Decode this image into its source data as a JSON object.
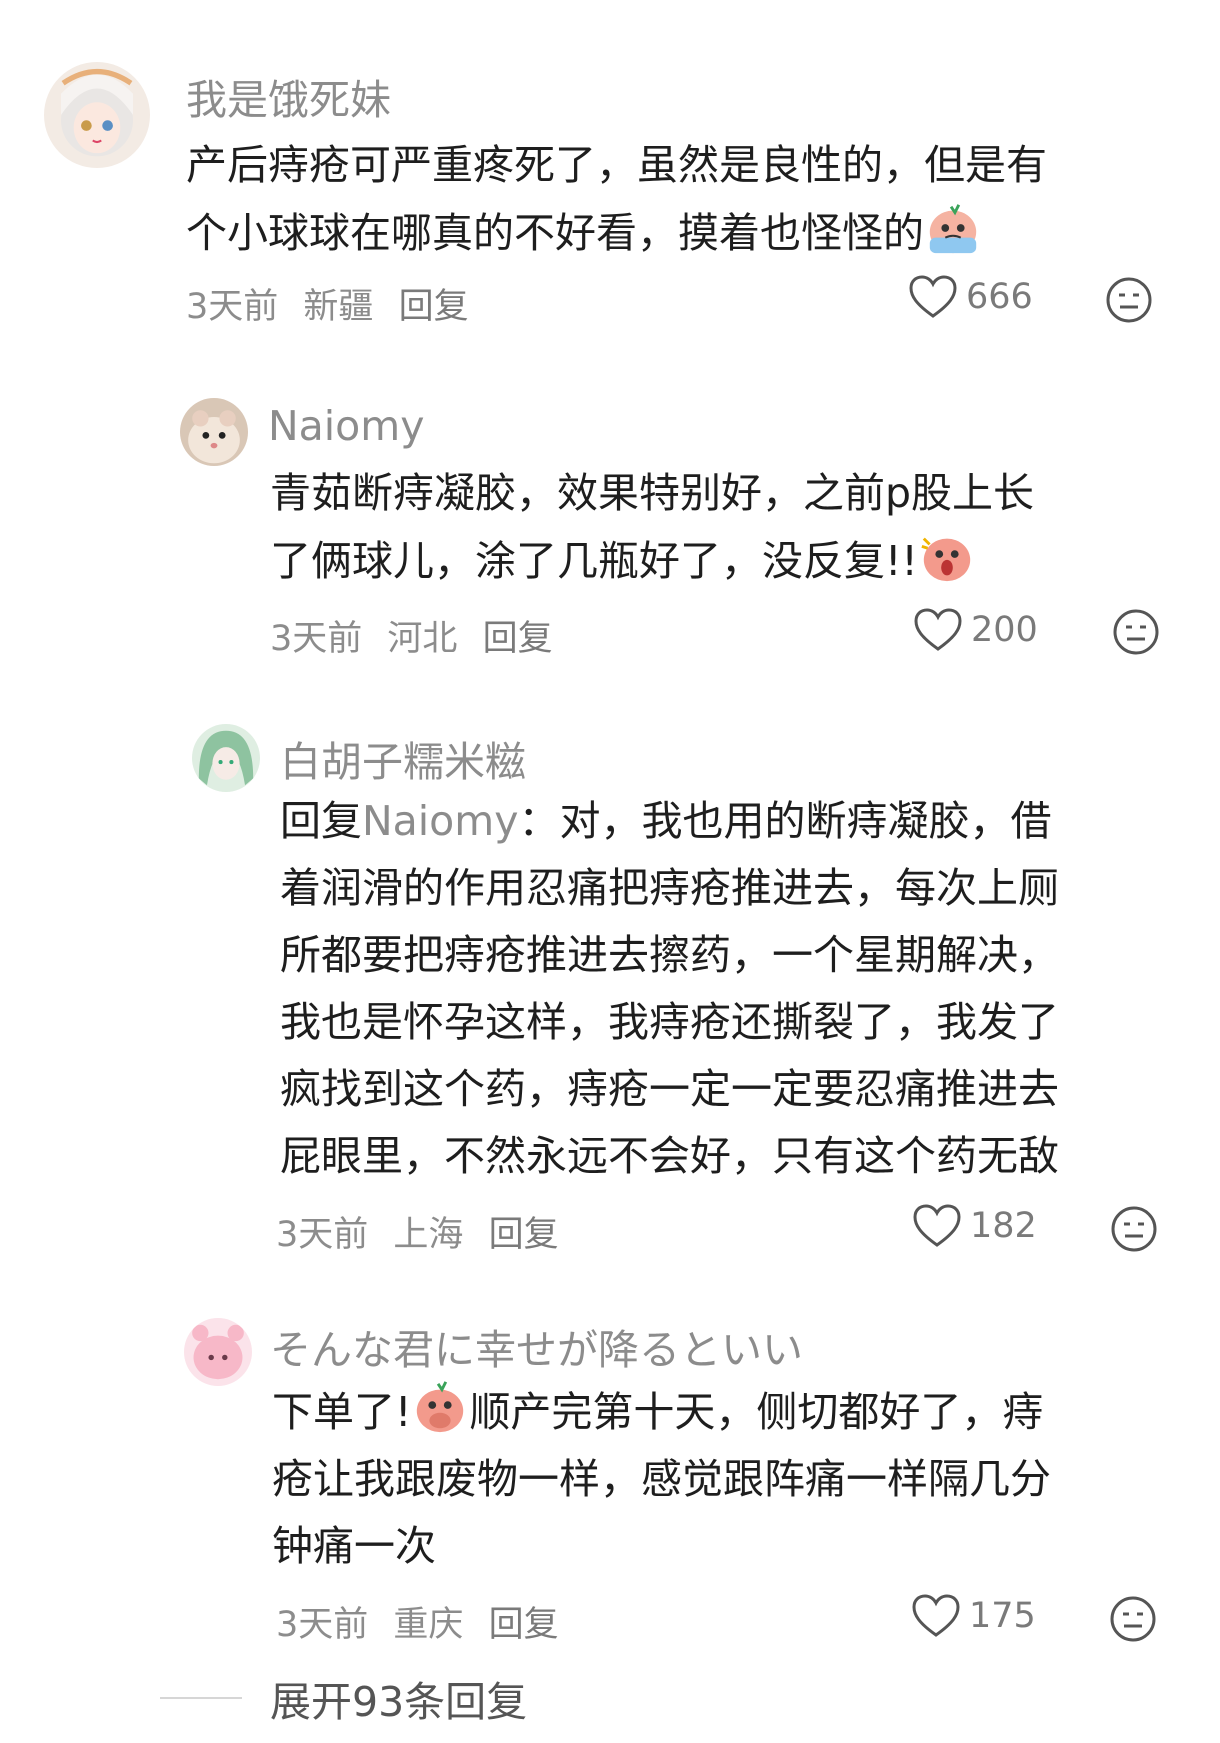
{
  "comments": [
    {
      "username": "我是饿死妹",
      "lines": [
        "产后痔疮可严重疼死了，虽然是良性的，但是有",
        "个小球球在哪真的不好看，摸着也怪怪的"
      ],
      "time": "3天前",
      "location": "新疆",
      "reply_label": "回复",
      "likes": "666"
    },
    {
      "username": "Naiomy",
      "lines": [
        "青茹断痔凝胶，效果特别好，之前p股上长",
        "了俩球儿，涂了几瓶好了，没反复!!"
      ],
      "time": "3天前",
      "location": "河北",
      "reply_label": "回复",
      "likes": "200"
    },
    {
      "username": "白胡子糯米糍",
      "reply_prefix": "回复",
      "reply_to": "Naiomy",
      "first_line_rest": "：对，我也用的断痔凝胶，借",
      "lines": [
        "着润滑的作用忍痛把痔疮推进去，每次上厕",
        "所都要把痔疮推进去擦药，一个星期解决，",
        "我也是怀孕这样，我痔疮还撕裂了，我发了",
        "疯找到这个药，痔疮一定一定要忍痛推进去",
        "屁眼里，不然永远不会好，只有这个药无敌"
      ],
      "time": "3天前",
      "location": "上海",
      "reply_label": "回复",
      "likes": "182"
    },
    {
      "username": "そんな君に幸せが降るといい",
      "first_line_a": "下单了!",
      "first_line_b": "顺产完第十天，侧切都好了，痔",
      "lines": [
        "疮让我跟废物一样，感觉跟阵痛一样隔几分",
        "钟痛一次"
      ],
      "time": "3天前",
      "location": "重庆",
      "reply_label": "回复",
      "likes": "175"
    }
  ],
  "expand_label": "展开93条回复",
  "colors": {
    "muted": "#8c8c8c",
    "text": "#1e1e1e",
    "emoji_peach": "#f39a8c"
  },
  "icons": [
    "heart-icon",
    "neutral-face-icon",
    "crying-emoji",
    "surprised-emoji",
    "covering-mouth-emoji"
  ]
}
